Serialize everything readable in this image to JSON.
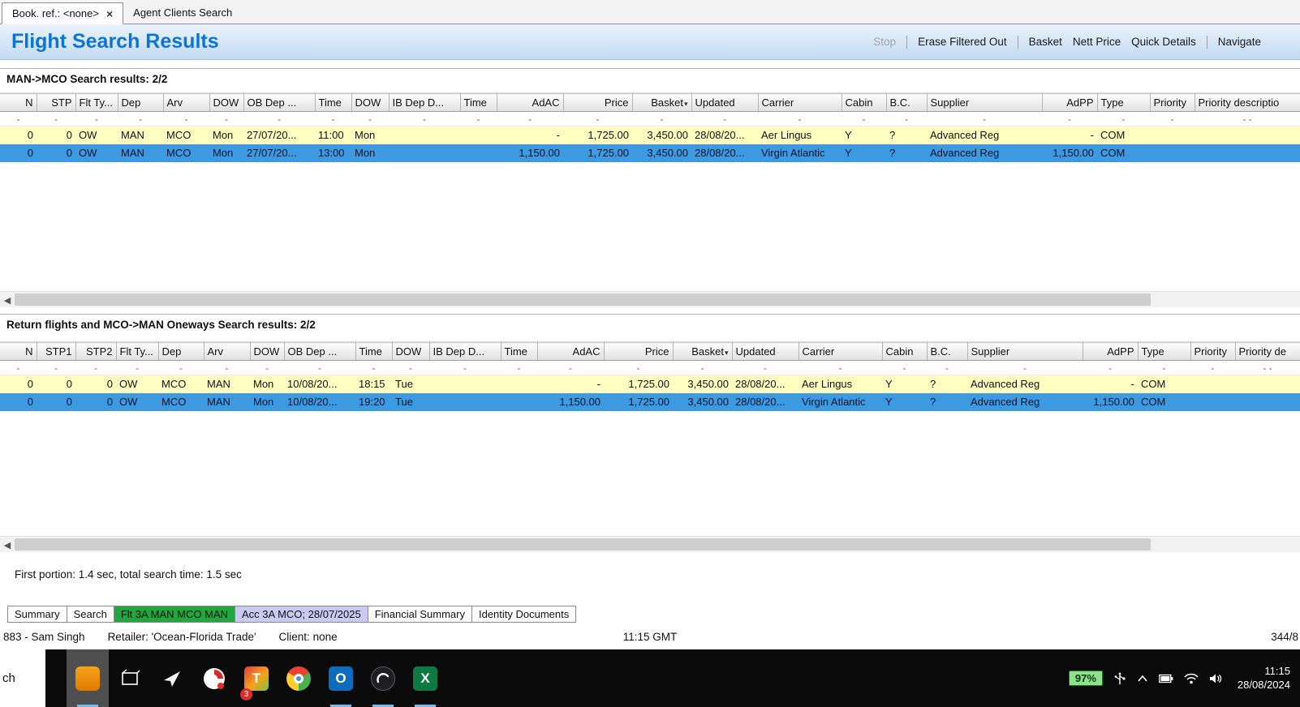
{
  "colors": {
    "title_blue": "#0b74d8",
    "row_highlight": "#ffffc2",
    "row_selected": "#3d9ae0",
    "tab_green": "#21a73d",
    "tab_lavender": "#c9c9f2",
    "battery_green": "#8ee28e"
  },
  "window_tabs": [
    {
      "label": "Book. ref.: <none>",
      "close": "×"
    },
    {
      "label": "Agent Clients Search"
    }
  ],
  "header": {
    "title": "Flight Search Results",
    "toolbar": {
      "stop": "Stop",
      "erase": "Erase Filtered Out",
      "basket": "Basket",
      "nett": "Nett Price",
      "quick": "Quick Details",
      "navigate": "Navigate"
    }
  },
  "outbound": {
    "title": "MAN->MCO Search results: 2/2",
    "sort_column": "Basket",
    "columns": [
      "N",
      "STP",
      "Flt Ty...",
      "Dep",
      "Arv",
      "DOW",
      "OB Dep ...",
      "Time",
      "DOW",
      "IB Dep D...",
      "Time",
      "AdAC",
      "Price",
      "Basket",
      "Updated",
      "Carrier",
      "Cabin",
      "B.C.",
      "Supplier",
      "AdPP",
      "Type",
      "Priority",
      "Priority descriptio"
    ],
    "filter_row": [
      "-",
      "-",
      "-",
      "-",
      "-",
      "-",
      "-",
      "-",
      "-",
      "-",
      "-",
      "-",
      "-",
      "-",
      "-",
      "-",
      "-",
      "-",
      "-",
      "-",
      "-",
      "-",
      "- -"
    ],
    "rows": [
      {
        "state": "highlight",
        "cells": [
          "0",
          "0",
          "OW",
          "MAN",
          "MCO",
          "Mon",
          "27/07/20...",
          "11:00",
          "Mon",
          "",
          "",
          "-",
          "1,725.00",
          "3,450.00",
          "28/08/20...",
          "Aer Lingus",
          "Y",
          "?",
          "Advanced Reg",
          "-",
          "COM",
          "",
          ""
        ]
      },
      {
        "state": "selected",
        "cells": [
          "0",
          "0",
          "OW",
          "MAN",
          "MCO",
          "Mon",
          "27/07/20...",
          "13:00",
          "Mon",
          "",
          "",
          "1,150.00",
          "1,725.00",
          "3,450.00",
          "28/08/20...",
          "Virgin Atlantic",
          "Y",
          "?",
          "Advanced Reg",
          "1,150.00",
          "COM",
          "",
          ""
        ]
      }
    ]
  },
  "inbound": {
    "title": "Return flights and MCO->MAN Oneways Search results: 2/2",
    "sort_column": "Basket",
    "columns": [
      "N",
      "STP1",
      "STP2",
      "Flt Ty...",
      "Dep",
      "Arv",
      "DOW",
      "OB Dep ...",
      "Time",
      "DOW",
      "IB Dep D...",
      "Time",
      "AdAC",
      "Price",
      "Basket",
      "Updated",
      "Carrier",
      "Cabin",
      "B.C.",
      "Supplier",
      "AdPP",
      "Type",
      "Priority",
      "Priority de"
    ],
    "filter_row": [
      "-",
      "-",
      "-",
      "-",
      "-",
      "-",
      "-",
      "-",
      "-",
      "-",
      "-",
      "-",
      "-",
      "-",
      "-",
      "-",
      "-",
      "-",
      "-",
      "-",
      "-",
      "-",
      "-",
      "- -"
    ],
    "rows": [
      {
        "state": "highlight",
        "cells": [
          "0",
          "0",
          "0",
          "OW",
          "MCO",
          "MAN",
          "Mon",
          "10/08/20...",
          "18:15",
          "Tue",
          "",
          "",
          "-",
          "1,725.00",
          "3,450.00",
          "28/08/20...",
          "Aer Lingus",
          "Y",
          "?",
          "Advanced Reg",
          "-",
          "COM",
          "",
          ""
        ]
      },
      {
        "state": "selected",
        "cells": [
          "0",
          "0",
          "0",
          "OW",
          "MCO",
          "MAN",
          "Mon",
          "10/08/20...",
          "19:20",
          "Tue",
          "",
          "",
          "1,150.00",
          "1,725.00",
          "3,450.00",
          "28/08/20...",
          "Virgin Atlantic",
          "Y",
          "?",
          "Advanced Reg",
          "1,150.00",
          "COM",
          "",
          ""
        ]
      }
    ]
  },
  "status_line": "First portion: 1.4 sec, total search time: 1.5 sec",
  "bottom_tabs": [
    "Summary",
    "Search",
    "Flt 3A MAN MCO MAN",
    "Acc 3A MCO; 28/07/2025",
    "Financial Summary",
    "Identity Documents"
  ],
  "statusbar": {
    "agent": "883 - Sam Singh",
    "retailer": "Retailer: 'Ocean-Florida Trade'",
    "client": "Client: none",
    "time": "11:15 GMT",
    "counter": "344/8"
  },
  "taskbar": {
    "search_text": "ch",
    "app3_badge": "3",
    "battery": "97%",
    "time": "11:15",
    "date": "28/08/2024"
  }
}
